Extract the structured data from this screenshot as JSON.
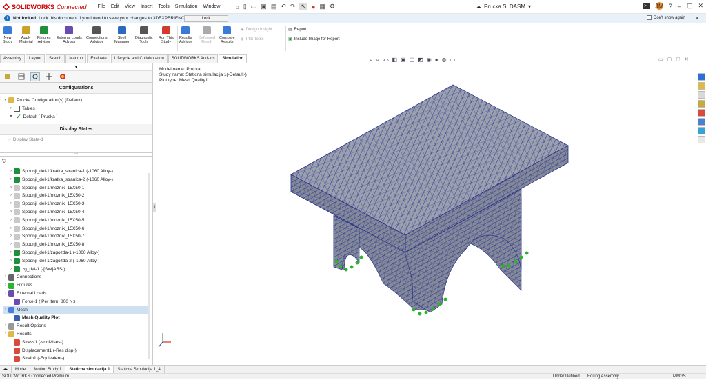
{
  "app": {
    "brand": "SOLIDWORKS",
    "brand_suffix": "Connected"
  },
  "menu": [
    "File",
    "Edit",
    "View",
    "Insert",
    "Tools",
    "Simulation",
    "Window"
  ],
  "document_title": "Prucka.SLDASM",
  "avatar_initials": "JM",
  "infobar": {
    "status": "Not locked",
    "message": "Lock this document if you intend to save your changes to 3DEXPERIENCE.",
    "lock_button": "Lock",
    "dont_show": "Don't show again"
  },
  "ribbon": {
    "buttons": [
      {
        "id": "new-study",
        "line1": "New",
        "line2": "Study",
        "color": "#3a7bd5"
      },
      {
        "id": "apply-material",
        "line1": "Apply",
        "line2": "Material",
        "color": "#c9a227"
      },
      {
        "id": "fixtures-advisor",
        "line1": "Fixtures",
        "line2": "Advisor",
        "color": "#1e8f3a"
      },
      {
        "id": "external-loads-advisor",
        "line1": "External Loads",
        "line2": "Advisor",
        "color": "#6b4bb0"
      },
      {
        "id": "connections-advisor",
        "line1": "Connections",
        "line2": "Advisor",
        "color": "#555555"
      },
      {
        "id": "shell-manager",
        "line1": "Shell",
        "line2": "Manager",
        "color": "#2a6bbf"
      },
      {
        "id": "diagnostic-tools",
        "line1": "Diagnostic",
        "line2": "Tools",
        "color": "#555555"
      },
      {
        "id": "run-this-study",
        "line1": "Run This",
        "line2": "Study",
        "color": "#d33b2c"
      },
      {
        "id": "results-advisor",
        "line1": "Results",
        "line2": "Advisor",
        "color": "#3a7bd5"
      },
      {
        "id": "deformed-result",
        "line1": "Deformed",
        "line2": "Result",
        "color": "#aaaaaa",
        "disabled": true
      },
      {
        "id": "compare-results",
        "line1": "Compare",
        "line2": "Results",
        "color": "#3a7bd5"
      }
    ],
    "design_insight": "Design Insight",
    "plot_tools": "Plot Tools",
    "report": "Report",
    "include_image": "Include Image for Report"
  },
  "tabs": [
    "Assembly",
    "Layout",
    "Sketch",
    "Markup",
    "Evaluate",
    "Lifecycle and Collaboration",
    "SOLIDWORKS Add-Ins",
    "Simulation"
  ],
  "active_tab": "Simulation",
  "config_panel": {
    "heading": "Configurations",
    "config_root": "Prucka Configuration(s)  (Default)",
    "tables": "Tables",
    "default": "Default [ Prucka ]",
    "display_states": "Display States",
    "display_state_1": "Display State-1"
  },
  "tree": [
    {
      "label": "Spodnji_del-1/kratka_stranica-1 (-1060 Alloy-)",
      "type": "part",
      "indent": 1,
      "grey": false
    },
    {
      "label": "Spodnji_del-1/kratka_stranica-2 (-1060 Alloy-)",
      "type": "part",
      "indent": 1,
      "grey": false
    },
    {
      "label": "Spodnji_del-1/moznik_15X50-1",
      "type": "part-grey",
      "indent": 1,
      "grey": false
    },
    {
      "label": "Spodnji_del-1/moznik_15X50-2",
      "type": "part-grey",
      "indent": 1,
      "grey": false
    },
    {
      "label": "Spodnji_del-1/moznik_15X50-3",
      "type": "part-grey",
      "indent": 1,
      "grey": false
    },
    {
      "label": "Spodnji_del-1/moznik_15X50-4",
      "type": "part-grey",
      "indent": 1,
      "grey": false
    },
    {
      "label": "Spodnji_del-1/moznik_15X50-5",
      "type": "part-grey",
      "indent": 1,
      "grey": false
    },
    {
      "label": "Spodnji_del-1/moznik_15X50-6",
      "type": "part-grey",
      "indent": 1,
      "grey": false
    },
    {
      "label": "Spodnji_del-1/moznik_15X50-7",
      "type": "part-grey",
      "indent": 1,
      "grey": false
    },
    {
      "label": "Spodnji_del-1/moznik_15X50-8",
      "type": "part-grey",
      "indent": 1,
      "grey": false
    },
    {
      "label": "Spodnji_del-1/zagozda-1 (-1060 Alloy-)",
      "type": "part",
      "indent": 1,
      "grey": false
    },
    {
      "label": "Spodnji_del-1/zagozda-2 (-1060 Alloy-)",
      "type": "part",
      "indent": 1,
      "grey": false
    },
    {
      "label": "zg_del-1 (-[SW]ABS-)",
      "type": "part",
      "indent": 1,
      "grey": false
    },
    {
      "label": "Connections",
      "type": "connections",
      "indent": 0,
      "grey": false
    },
    {
      "label": "Fixtures",
      "type": "fixtures",
      "indent": 0,
      "grey": false
    },
    {
      "label": "External Loads",
      "type": "loads",
      "indent": 0,
      "grey": false
    },
    {
      "label": "Force-1 (:Per item: 800 N:)",
      "type": "force",
      "indent": 1,
      "grey": false
    },
    {
      "label": "Mesh",
      "type": "mesh",
      "indent": 0,
      "grey": false
    },
    {
      "label": "Mesh Quality Plot",
      "type": "meshplot",
      "indent": 1,
      "grey": false
    },
    {
      "label": "Result Options",
      "type": "options",
      "indent": 0,
      "grey": false
    },
    {
      "label": "Results",
      "type": "results",
      "indent": 0,
      "grey": false
    },
    {
      "label": "Stress1 (-vonMises-)",
      "type": "plot",
      "indent": 1,
      "grey": false
    },
    {
      "label": "Displacement1 (-Res disp-)",
      "type": "plot",
      "indent": 1,
      "grey": false
    },
    {
      "label": "Strain1 (-Equivalent-)",
      "type": "plot",
      "indent": 1,
      "grey": false
    }
  ],
  "viewport": {
    "model_name": "Model name: Prucka",
    "study_name": "Study name: Staticna simulacija 1(-Default-)",
    "plot_type": "Plot type: Mesh Quality1"
  },
  "bottom_tabs": [
    "Model",
    "Motion Study 1",
    "Staticna simulacija 1",
    "Staticna Simulacija 1_4"
  ],
  "active_bottom_tab": "Staticna simulacija 1",
  "status": {
    "left": "SOLIDWORKS Connected Premium",
    "defined": "Under Defined",
    "mode": "Editing Assembly",
    "units": "MMGS"
  }
}
